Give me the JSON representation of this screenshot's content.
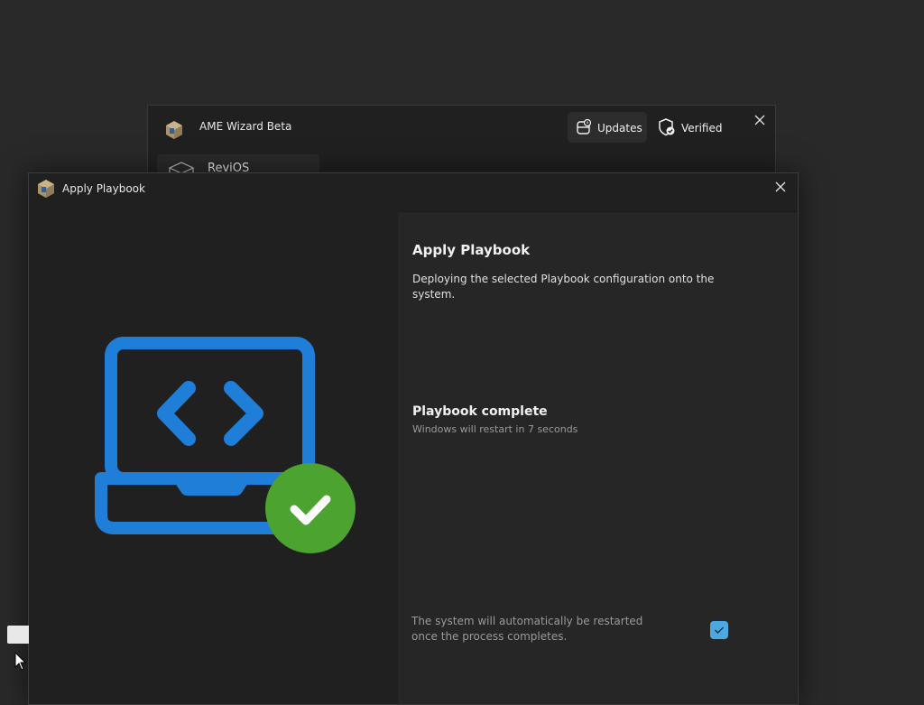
{
  "background_window": {
    "title": "AME Wizard Beta",
    "updates_label": "Updates",
    "verified_label": "Verified",
    "sidebar_item_label": "ReviOS"
  },
  "dialog": {
    "title": "Apply Playbook",
    "heading": "Apply Playbook",
    "description": "Deploying the selected Playbook configuration onto the system.",
    "status_title": "Playbook complete",
    "status_subtitle": "Windows will restart in 7 seconds",
    "restart_option_text": "The system will automatically be restarted once the process completes.",
    "restart_option_checked": true
  },
  "colors": {
    "accent": "#4ca8e0",
    "laptop_blue": "#1f7fd8",
    "success_green": "#4ca32f",
    "background": "#292929"
  },
  "icons": [
    "app-icon",
    "updates-icon",
    "verified-shield-icon",
    "close-icon",
    "cube-icon",
    "laptop-code-icon",
    "checkmark-icon",
    "mouse-cursor-icon"
  ]
}
